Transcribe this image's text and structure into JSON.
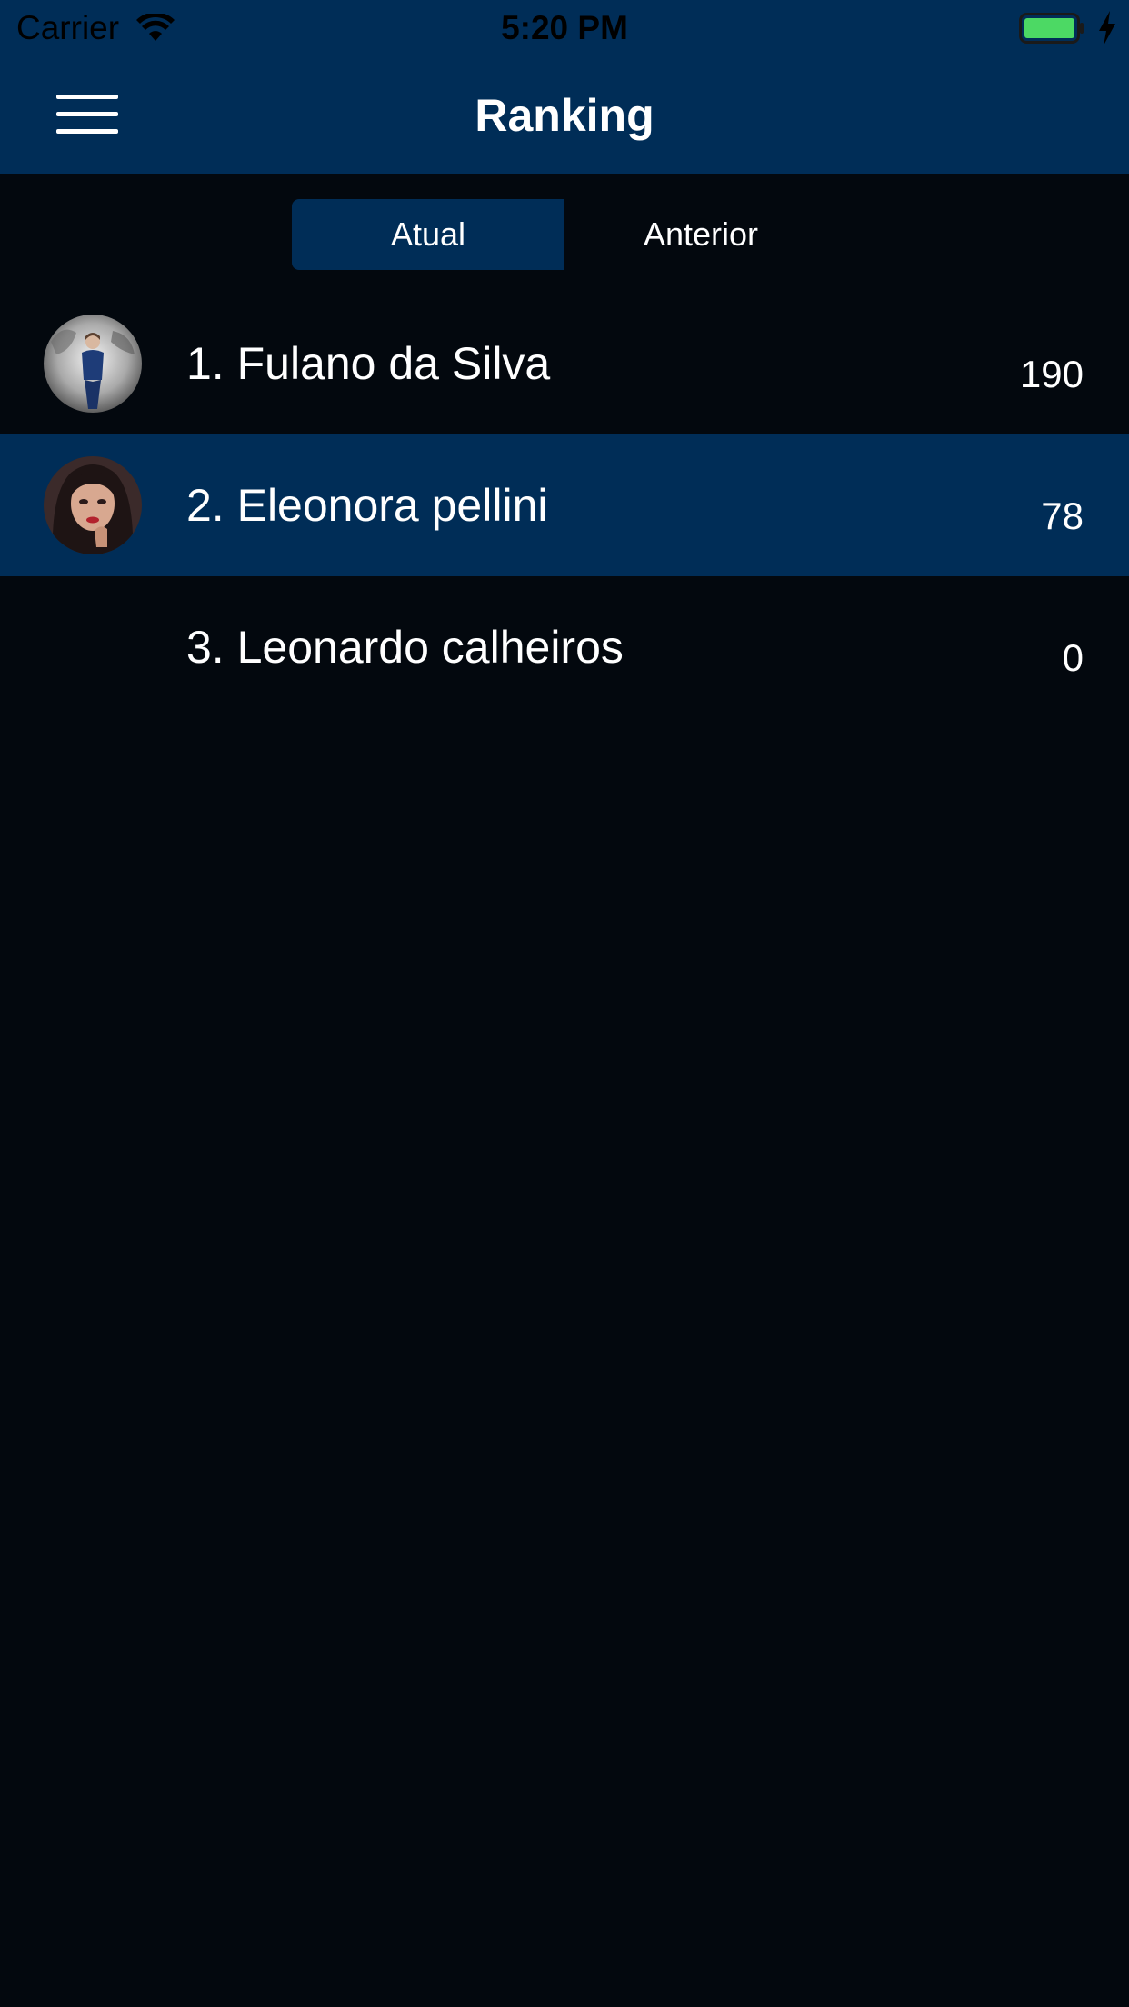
{
  "status_bar": {
    "carrier": "Carrier",
    "time": "5:20 PM",
    "wifi_icon": "wifi-icon",
    "battery_icon": "battery-charging-icon"
  },
  "header": {
    "title": "Ranking",
    "menu_icon": "hamburger-menu-icon"
  },
  "tabs": [
    {
      "label": "Atual",
      "selected": true
    },
    {
      "label": "Anterior",
      "selected": false
    }
  ],
  "ranking": [
    {
      "name": "1. Fulano da Silva",
      "points": "190",
      "has_avatar": true,
      "highlighted": false
    },
    {
      "name": "2. Eleonora pellini",
      "points": "78",
      "has_avatar": true,
      "highlighted": true
    },
    {
      "name": "3. Leonardo calheiros",
      "points": "0",
      "has_avatar": false,
      "highlighted": false
    }
  ],
  "colors": {
    "primary": "#002d57",
    "background": "#03080e",
    "battery": "#4cd964",
    "text": "#ffffff"
  }
}
